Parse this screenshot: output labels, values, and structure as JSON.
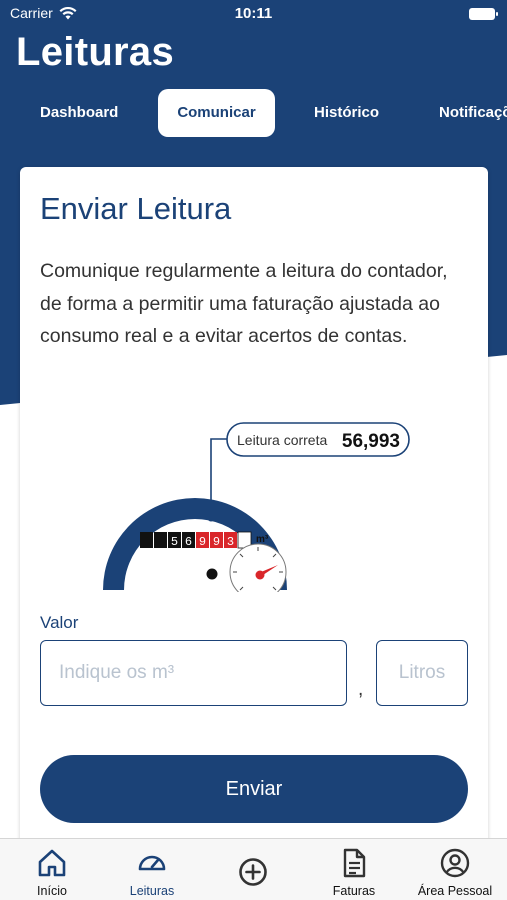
{
  "status_bar": {
    "carrier": "Carrier",
    "time": "10:11"
  },
  "page": {
    "title": "Leituras"
  },
  "tabs": [
    {
      "label": "Dashboard",
      "active": false
    },
    {
      "label": "Comunicar",
      "active": true
    },
    {
      "label": "Histórico",
      "active": false
    },
    {
      "label": "Notificaçõ",
      "active": false
    }
  ],
  "card": {
    "title": "Enviar Leitura",
    "description": "Comunique regularmente a leitura do contador, de forma a permitir uma faturação ajustada ao consumo real e a evitar acertos de contas."
  },
  "meter": {
    "callout_label": "Leitura correta",
    "callout_value": "56,993",
    "digits": [
      "",
      "5",
      "6",
      "9",
      "9",
      "3"
    ],
    "unit": "m³"
  },
  "form": {
    "label": "Valor",
    "m3_placeholder": "Indique os m³",
    "separator": ",",
    "litros_placeholder": "Litros",
    "submit_label": "Enviar"
  },
  "bottom_nav": [
    {
      "label": "Início",
      "icon": "home-icon",
      "active": false
    },
    {
      "label": "Leituras",
      "icon": "gauge-icon",
      "active": true
    },
    {
      "label": "",
      "icon": "add-circle-icon",
      "active": false
    },
    {
      "label": "Faturas",
      "icon": "document-icon",
      "active": false
    },
    {
      "label": "Área Pessoal",
      "icon": "user-circle-icon",
      "active": false
    }
  ],
  "colors": {
    "brand": "#1b4277",
    "background": "#ffffff",
    "placeholder": "#b9c3cf",
    "meter_red": "#d9262a"
  }
}
